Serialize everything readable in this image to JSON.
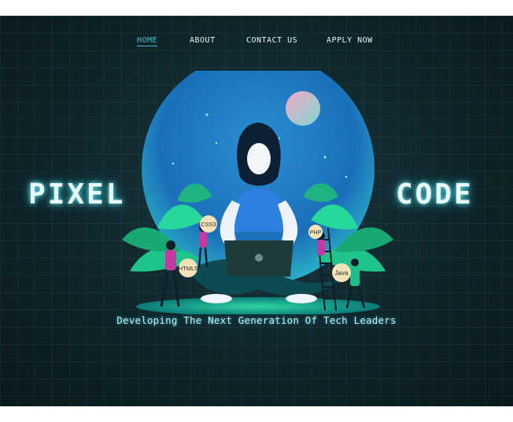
{
  "nav": {
    "items": [
      {
        "label": "HOME",
        "active": true
      },
      {
        "label": "ABOUT",
        "active": false
      },
      {
        "label": "CONTACT US",
        "active": false
      },
      {
        "label": "APPLY NOW",
        "active": false
      }
    ]
  },
  "hero": {
    "left_word": "PIXEL",
    "right_word": "CODE",
    "tagline": "Developing The Next Generation Of Tech Leaders"
  },
  "bubbles": {
    "css": "CSS3",
    "html": "HTML5",
    "php": "PHP",
    "java": "Java"
  },
  "colors": {
    "accent": "#3fc0d0",
    "glow": "#6fe6f0",
    "background": "#0f2429"
  },
  "icons": [
    "moon-icon",
    "stars-icon",
    "laptop-icon",
    "ladder-icon"
  ]
}
